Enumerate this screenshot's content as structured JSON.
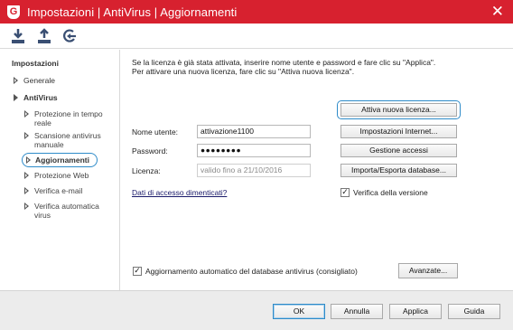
{
  "window": {
    "logo_letter": "G",
    "title": "Impostazioni | AntiVirus | Aggiornamenti",
    "close_label": "✕",
    "accent_color": "#d7212f",
    "focus_color": "#2e8bc9"
  },
  "toolbar": {
    "icons": [
      "import-icon",
      "export-icon",
      "reset-icon"
    ]
  },
  "sidebar": {
    "header": "Impostazioni",
    "generale": "Generale",
    "antivirus": "AntiVirus",
    "items": [
      "Protezione in tempo reale",
      "Scansione antivirus manuale",
      "Aggiornamenti",
      "Protezione Web",
      "Verifica e-mail",
      "Verifica automatica virus"
    ],
    "active_item": "Aggiornamenti"
  },
  "main": {
    "intro_line1": "Se la licenza è già stata attivata, inserire nome utente e password e fare clic su \"Applica\".",
    "intro_line2": "Per attivare una nuova licenza, fare clic su \"Attiva nuova licenza\".",
    "username_label": "Nome utente:",
    "username_value": "attivazione1100",
    "password_label": "Password:",
    "password_value": "●●●●●●●●",
    "license_label": "Licenza:",
    "license_value": "valido fino a 21/10/2016",
    "forgot_link": "Dati di accesso dimenticati?",
    "btn_activate": "Attiva nuova licenza...",
    "btn_internet": "Impostazioni Internet...",
    "btn_access": "Gestione accessi",
    "btn_import_export": "Importa/Esporta database...",
    "version_check_label": "Verifica della versione",
    "version_check_checked": true,
    "auto_update_label": "Aggiornamento automatico del database antivirus (consigliato)",
    "auto_update_checked": true,
    "btn_advanced": "Avanzate..."
  },
  "footer": {
    "ok": "OK",
    "cancel": "Annulla",
    "apply": "Applica",
    "help": "Guida"
  }
}
